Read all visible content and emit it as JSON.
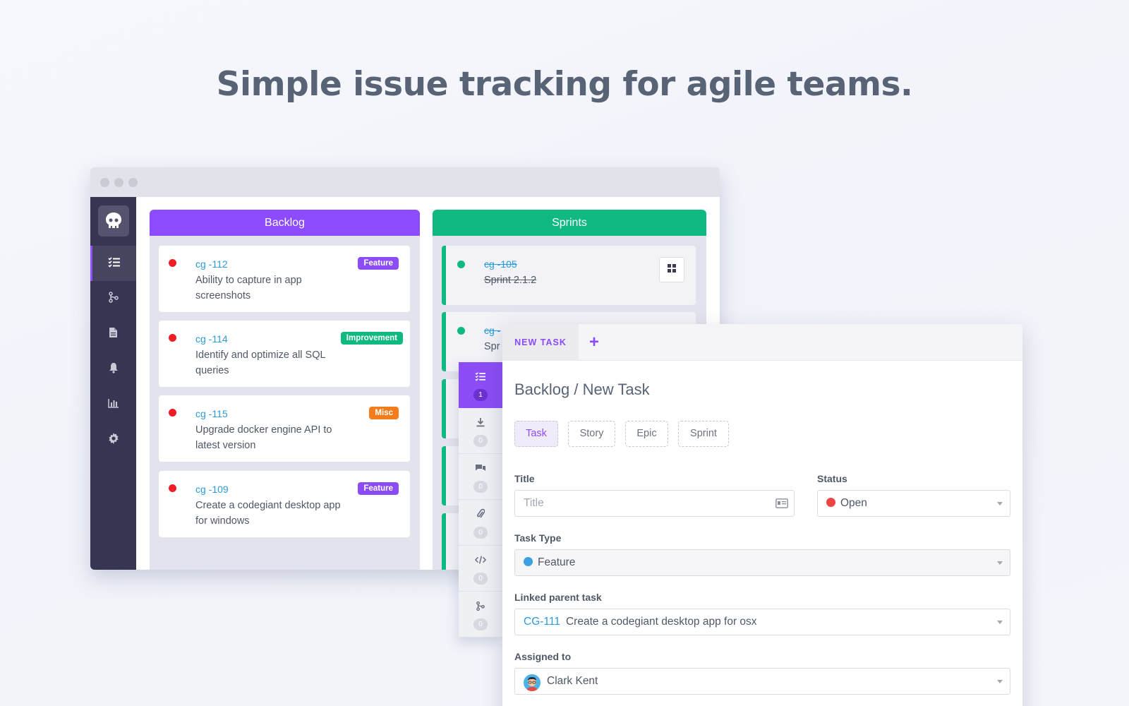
{
  "headline": "Simple issue tracking for agile teams.",
  "colors": {
    "purple": "#8b4cf5",
    "green": "#10b981",
    "red": "#ee1c25",
    "orange": "#f37c1d",
    "sidebar": "#373552",
    "link": "#2a9bd9"
  },
  "sidebar": {
    "logo_icon": "skull-logo-icon",
    "items": [
      {
        "icon": "task-list-icon",
        "active": true
      },
      {
        "icon": "git-branch-icon",
        "active": false
      },
      {
        "icon": "document-icon",
        "active": false
      },
      {
        "icon": "bell-icon",
        "active": false
      },
      {
        "icon": "bar-chart-icon",
        "active": false
      },
      {
        "icon": "gear-icon",
        "active": false
      }
    ]
  },
  "backlog": {
    "title": "Backlog",
    "cards": [
      {
        "id": "cg -112",
        "title": "Ability to capture in app screenshots",
        "tag": "Feature",
        "tag_color": "#8b4cf5"
      },
      {
        "id": "cg -114",
        "title": "Identify and optimize all SQL queries",
        "tag": "Improvement",
        "tag_color": "#10b981"
      },
      {
        "id": "cg -115",
        "title": "Upgrade docker engine API to latest version",
        "tag": "Misc",
        "tag_color": "#f37c1d"
      },
      {
        "id": "cg -109",
        "title": "Create a codegiant desktop app for windows",
        "tag": "Feature",
        "tag_color": "#8b4cf5"
      }
    ]
  },
  "sprints": {
    "title": "Sprints",
    "cards": [
      {
        "id": "cg -105",
        "title": "Sprint 2.1.2"
      },
      {
        "id": "cg -",
        "title": "Spr"
      }
    ]
  },
  "task_side_tabs": [
    {
      "icon": "task-list-icon",
      "count": "1",
      "active": true
    },
    {
      "icon": "download-icon",
      "count": "0",
      "active": false
    },
    {
      "icon": "comments-icon",
      "count": "0",
      "active": false
    },
    {
      "icon": "paperclip-icon",
      "count": "0",
      "active": false
    },
    {
      "icon": "code-icon",
      "count": "0",
      "active": false
    },
    {
      "icon": "git-branch-icon",
      "count": "0",
      "active": false
    }
  ],
  "task_panel": {
    "tab_label": "NEW TASK",
    "add_icon": "plus-icon",
    "breadcrumb": "Backlog / New Task",
    "types": [
      "Task",
      "Story",
      "Epic",
      "Sprint"
    ],
    "selected_type": "Task",
    "fields": {
      "title_label": "Title",
      "title_placeholder": "Title",
      "status_label": "Status",
      "status_value": "Open",
      "status_color": "#ef4444",
      "task_type_label": "Task Type",
      "task_type_value": "Feature",
      "task_type_color": "#3b9fe0",
      "parent_label": "Linked parent task",
      "parent_id": "CG-111",
      "parent_title": "Create a codegiant desktop app for osx",
      "assigned_label": "Assigned to",
      "assigned_value": "Clark Kent"
    }
  }
}
